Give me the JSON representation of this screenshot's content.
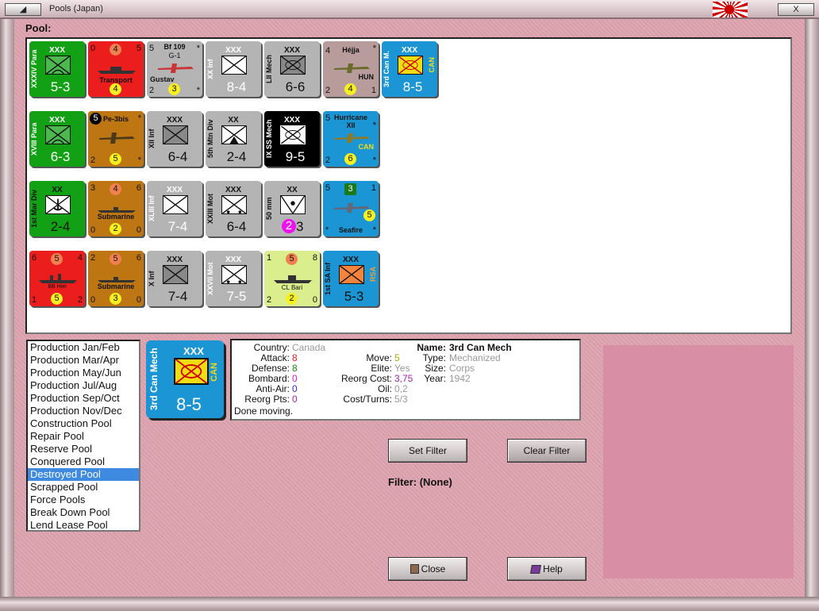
{
  "window": {
    "title": "Pools (Japan)",
    "button_left": "◢",
    "button_right": "X"
  },
  "pool": {
    "label": "Pool:"
  },
  "colors": {
    "accent": "#3e8ae0",
    "background": "#dba4b0",
    "can_blue": "#1c95d4"
  },
  "counters": {
    "c0": {
      "size": "XXX",
      "name": "XXXIV Para",
      "str": "5-3"
    },
    "c1": {
      "tl": "0",
      "top": "4",
      "tr": "5",
      "label": "Transport",
      "bot": "4"
    },
    "c2": {
      "title": "Bf 109",
      "sub": "G-1",
      "tl": "5",
      "tr": "*",
      "label": "Gustav",
      "bl": "2",
      "bot": "3",
      "br": "*"
    },
    "c3": {
      "size": "XXX",
      "name": "XX Inf",
      "str": "8-4"
    },
    "c4": {
      "size": "XXX",
      "name": "LII Mech",
      "str": "6-6"
    },
    "c5": {
      "title": "Héjja",
      "tl": "4",
      "tr": "*",
      "label": "HUN",
      "bl": "2",
      "bot": "4",
      "br": "1"
    },
    "c6": {
      "size": "XXX",
      "name": "3rd Can M.",
      "nat": "CAN",
      "str": "8-5"
    },
    "c7": {
      "size": "XXX",
      "name": "XVIII Para",
      "str": "6-3"
    },
    "c8": {
      "title": "Pe-3bis",
      "top": "5",
      "tr": "*",
      "bl": "2",
      "bot": "5",
      "br": "*"
    },
    "c9": {
      "size": "XXX",
      "name": "XII Inf",
      "str": "6-4"
    },
    "c10": {
      "size": "XX",
      "name": "5th Mtn Div",
      "str": "2-4"
    },
    "c11": {
      "size": "XXX",
      "name": "IX SS Mech",
      "str": "9-5"
    },
    "c12": {
      "title": "Hurricane",
      "sub": "XII",
      "tl": "5",
      "tr": "*",
      "label": "CAN",
      "bl": "2",
      "bot": "6",
      "br": "*"
    },
    "c13": {
      "size": "XX",
      "name": "1st Mar Div",
      "str": "2-4"
    },
    "c14": {
      "tl": "3",
      "top": "4",
      "tr": "6",
      "label": "Submarine",
      "bl": "0",
      "bot": "2",
      "br": "0"
    },
    "c15": {
      "size": "XXX",
      "name": "XLIII Inf",
      "str": "7-4"
    },
    "c16": {
      "size": "XXX",
      "name": "XXIII Mot",
      "str": "6-4"
    },
    "c17": {
      "size": "XX",
      "name": "50 mm",
      "bot": "2",
      "str": "3"
    },
    "c18": {
      "tl": "5",
      "top": "3",
      "tr": "1",
      "mid": "5",
      "label": "Seafire",
      "bl": "*",
      "br": "*"
    },
    "c19": {
      "tl": "6",
      "top": "5",
      "tr": "4",
      "label": "BB Hiei",
      "bl": "1",
      "bot": "5",
      "br": "2"
    },
    "c20": {
      "tl": "2",
      "top": "5",
      "tr": "6",
      "label": "Submarine",
      "bl": "0",
      "bot": "3",
      "br": "0"
    },
    "c21": {
      "size": "XXX",
      "name": "X Inf",
      "str": "7-4"
    },
    "c22": {
      "size": "XXX",
      "name": "XXVII Mot",
      "str": "7-5"
    },
    "c23": {
      "tl": "1",
      "top": "5",
      "tr": "8",
      "label": "CL Bari",
      "bl": "2",
      "bot": "2",
      "br": "0"
    },
    "c24": {
      "size": "XXX",
      "name": "1st SA Inf",
      "nat": "RSA",
      "str": "5-3"
    }
  },
  "list": [
    "Production Jan/Feb",
    "Production Mar/Apr",
    "Production May/Jun",
    "Production Jul/Aug",
    "Production Sep/Oct",
    "Production Nov/Dec",
    "Construction Pool",
    "Repair Pool",
    "Reserve Pool",
    "Conquered Pool",
    "Destroyed Pool",
    "Scrapped Pool",
    "Force Pools",
    "Break Down Pool",
    "Lend Lease Pool"
  ],
  "selected": {
    "size": "XXX",
    "name": "3rd Can Mech",
    "nat": "CAN",
    "str": "8-5"
  },
  "info": {
    "country_k": "Country:",
    "country_v": "Canada",
    "attack_k": "Attack:",
    "attack_v": "8",
    "defense_k": "Defense:",
    "defense_v": "8",
    "bombard_k": "Bombard:",
    "bombard_v": "0",
    "aa_k": "Anti-Air:",
    "aa_v": "0",
    "reorgpts_k": "Reorg Pts:",
    "reorgpts_v": "0",
    "done": "Done moving.",
    "move_k": "Move:",
    "move_v": "5",
    "elite_k": "Elite:",
    "elite_v": "Yes",
    "reorgcost_k": "Reorg Cost:",
    "reorgcost_v": "3,75",
    "oil_k": "Oil:",
    "oil_v": "0,2",
    "costturns_k": "Cost/Turns:",
    "costturns_v": "5/3",
    "name_k": "Name:",
    "name_v": "3rd Can Mech",
    "type_k": "Type:",
    "type_v": "Mechanized",
    "size_k": "Size:",
    "size_v": "Corps",
    "year_k": "Year:",
    "year_v": "1942"
  },
  "buttons": {
    "set_filter": "Set Filter",
    "clear_filter": "Clear Filter",
    "close": "Close",
    "help": "Help"
  },
  "filter": {
    "label": "Filter: (None)"
  }
}
